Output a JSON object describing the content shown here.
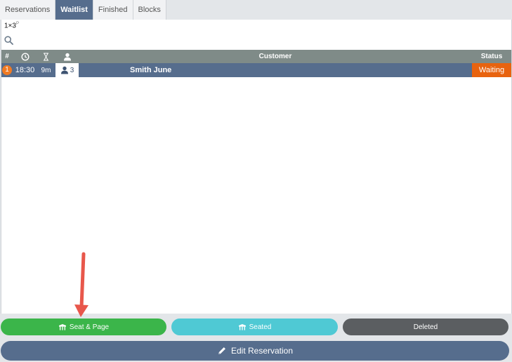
{
  "tabs": [
    {
      "label": "Reservations"
    },
    {
      "label": "Waitlist",
      "active": true
    },
    {
      "label": "Finished"
    },
    {
      "label": "Blocks"
    }
  ],
  "info": {
    "main": "1×3",
    "sup": "P"
  },
  "search": {
    "value": "",
    "placeholder": ""
  },
  "table": {
    "headers": {
      "number": "#",
      "customer": "Customer",
      "status": "Status"
    },
    "rows": [
      {
        "number": "1",
        "time": "18:30",
        "waited": "9m",
        "party": "3",
        "customer": "Smith June",
        "status": "Waiting"
      }
    ]
  },
  "buttons": {
    "seat_page": "Seat & Page",
    "seated": "Seated",
    "deleted": "Deleted",
    "edit": "Edit Reservation"
  },
  "colors": {
    "accent": "#566d8d",
    "header": "#7f8b88",
    "status_waiting": "#e8630f",
    "seat_page": "#3bb54a",
    "seated": "#4fc9d4",
    "deleted": "#5b5e61",
    "annotation_arrow": "#e8574b"
  },
  "icons": {
    "header": [
      "clock-icon",
      "hourglass-icon",
      "person-icon"
    ],
    "search": "search-icon",
    "table": "table-icon",
    "edit": "pencil-icon"
  }
}
